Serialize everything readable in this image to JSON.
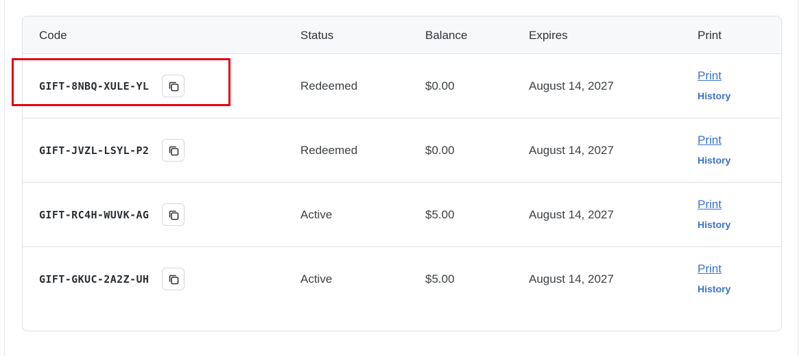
{
  "table": {
    "headers": {
      "code": "Code",
      "status": "Status",
      "balance": "Balance",
      "expires": "Expires",
      "print": "Print"
    },
    "rows": [
      {
        "code": "GIFT-8NBQ-XULE-YL",
        "status": "Redeemed",
        "balance": "$0.00",
        "expires": "August 14, 2027",
        "print_label": "Print",
        "history_label": "History"
      },
      {
        "code": "GIFT-JVZL-LSYL-P2",
        "status": "Redeemed",
        "balance": "$0.00",
        "expires": "August 14, 2027",
        "print_label": "Print",
        "history_label": "History"
      },
      {
        "code": "GIFT-RC4H-WUVK-AG",
        "status": "Active",
        "balance": "$5.00",
        "expires": "August 14, 2027",
        "print_label": "Print",
        "history_label": "History"
      },
      {
        "code": "GIFT-GKUC-2A2Z-UH",
        "status": "Active",
        "balance": "$5.00",
        "expires": "August 14, 2027",
        "print_label": "Print",
        "history_label": "History"
      }
    ]
  },
  "icons": {
    "copy": "copy-icon"
  },
  "colors": {
    "link": "#3a73c9",
    "highlight": "#e3000f",
    "header_bg": "#f7f8fa",
    "border": "#dde1e6"
  }
}
